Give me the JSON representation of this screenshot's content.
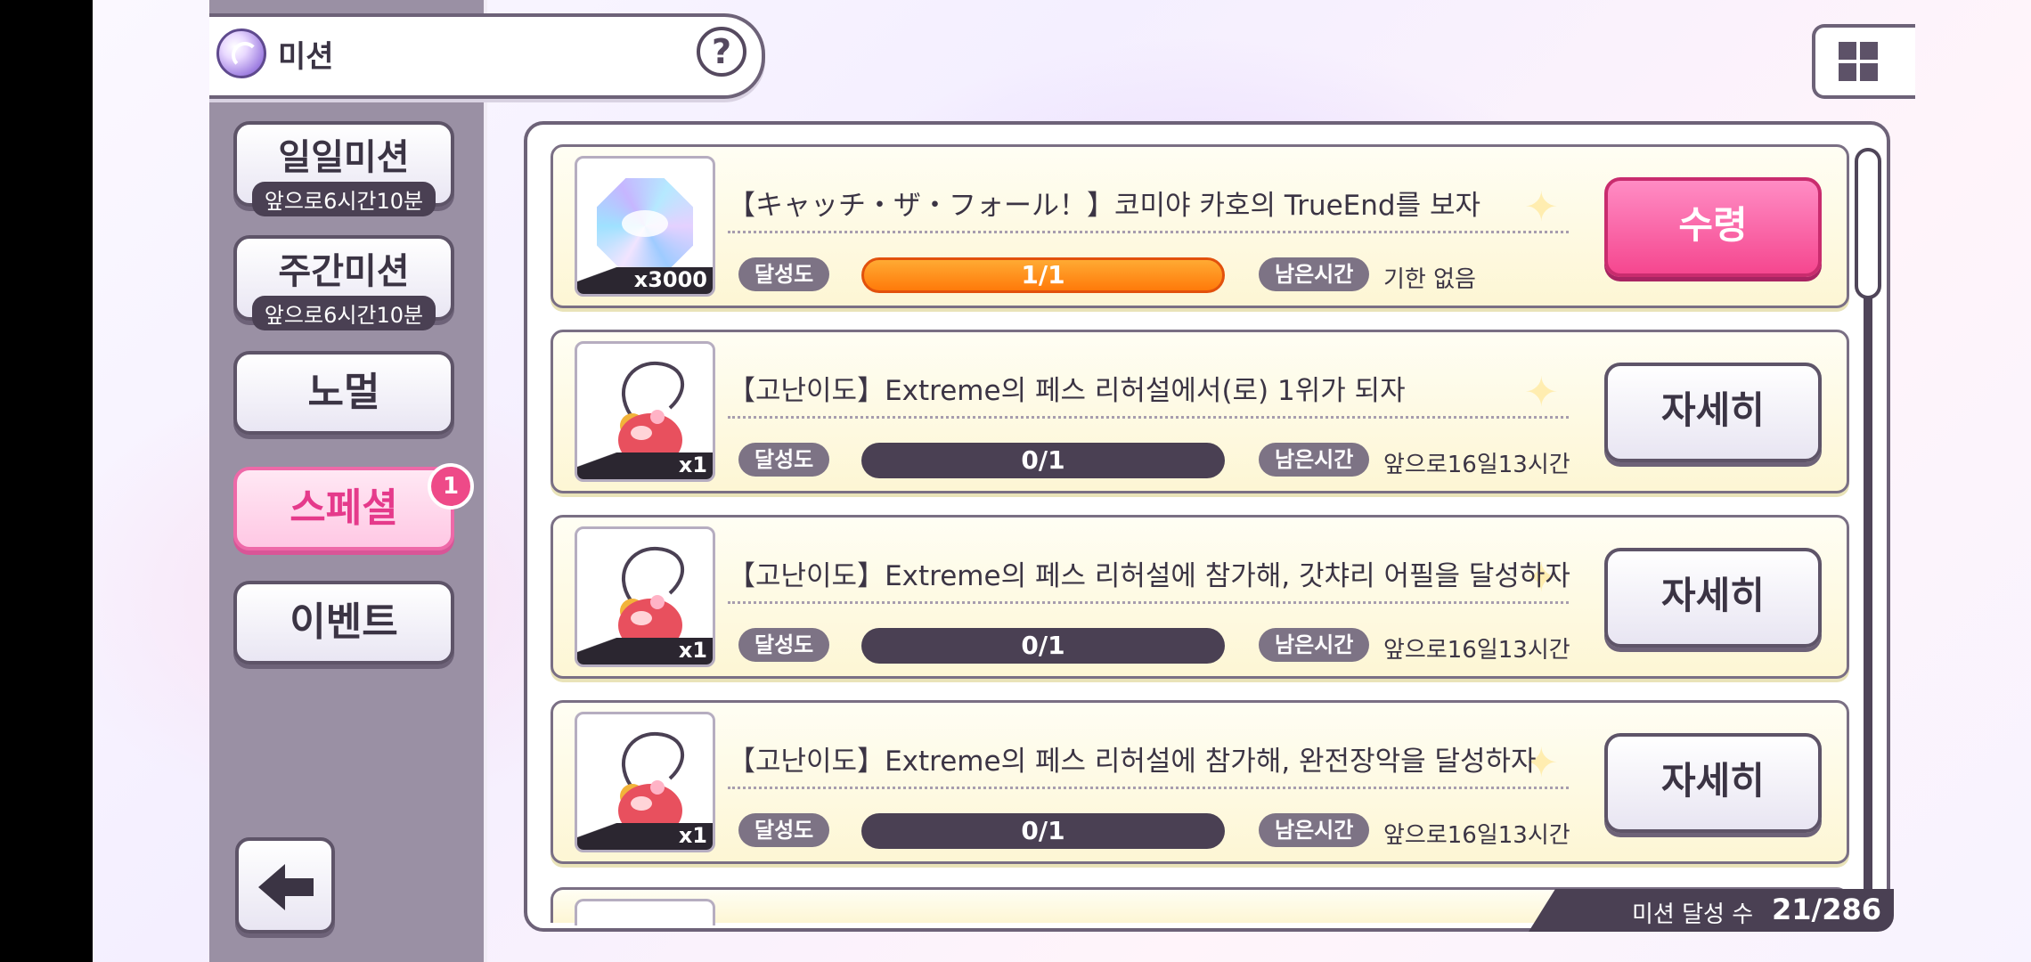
{
  "header": {
    "title": "미션",
    "help_label": "?"
  },
  "sidebar": {
    "tabs": [
      {
        "label": "일일미션",
        "sub": "앞으로6시간10분"
      },
      {
        "label": "주간미션",
        "sub": "앞으로6시간10분"
      },
      {
        "label": "노멀"
      },
      {
        "label": "스페셜",
        "badge": "1"
      },
      {
        "label": "이벤트"
      }
    ]
  },
  "labels": {
    "progress": "달성도",
    "remaining": "남은시간"
  },
  "missions": [
    {
      "title": "【キャッチ・ザ・フォール！】코미야 카호의 TrueEnd를 보자",
      "reward_icon": "star-gem-icon",
      "reward_count": "x3000",
      "progress": "1/1",
      "remaining": "기한 없음",
      "button": "수령"
    },
    {
      "title": "【고난이도】Extreme의 페스 리허설에서(로) 1위가 되자",
      "reward_icon": "charm-icon",
      "reward_count": "x1",
      "progress": "0/1",
      "remaining": "앞으로16일13시간",
      "button": "자세히"
    },
    {
      "title": "【고난이도】Extreme의 페스 리허설에 참가해, 갓챠리 어필을 달성하자",
      "reward_icon": "charm-icon",
      "reward_count": "x1",
      "progress": "0/1",
      "remaining": "앞으로16일13시간",
      "button": "자세히"
    },
    {
      "title": "【고난이도】Extreme의 페스 리허설에 참가해, 완전장악을 달성하자",
      "reward_icon": "charm-icon",
      "reward_count": "x1",
      "progress": "0/1",
      "remaining": "앞으로16일13시간",
      "button": "자세히"
    }
  ],
  "footer": {
    "counter_label": "미션 달성 수",
    "counter_value": "21/286"
  },
  "colors": {
    "accent_pink": "#f5478f",
    "progress_orange": "#ff7a0a",
    "dark": "#4a4053"
  }
}
